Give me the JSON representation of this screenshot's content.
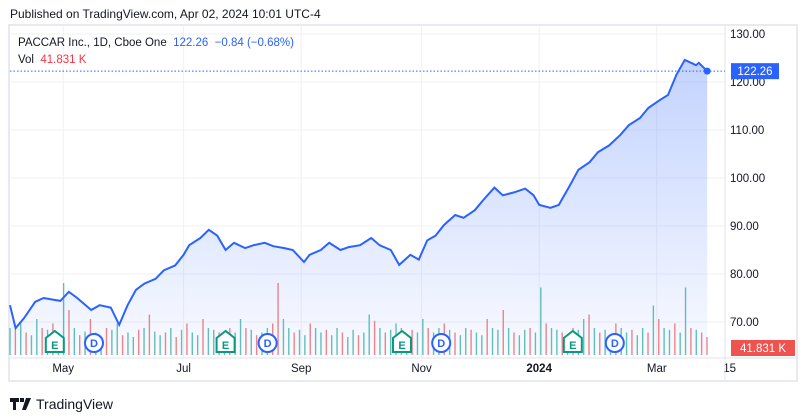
{
  "header": {
    "published": "Published on TradingView.com, Apr 02, 2024 10:01 UTC-4"
  },
  "legend": {
    "symbol": "PACCAR Inc., 1D, Cboe One",
    "price": "122.26",
    "change": "−0.84 (−0.68%)",
    "vol_label": "Vol",
    "vol_value": "41.831 K"
  },
  "footer": {
    "brand": "TradingView"
  },
  "colors": {
    "line": "#2962ff",
    "up": "#26a69a",
    "down": "#ef5350",
    "event_e": "#089981",
    "event_d": "#2962ff"
  },
  "chart_data": {
    "type": "area",
    "title": "PACCAR Inc., 1D, Cboe One",
    "ylim": [
      66,
      131
    ],
    "y_ticks": [
      "130.00",
      "120.00",
      "110.00",
      "100.00",
      "90.00",
      "80.00",
      "70.00"
    ],
    "y_tick_values": [
      130,
      120,
      110,
      100,
      90,
      80,
      70
    ],
    "x_ticks": [
      {
        "label": "May",
        "day": 19
      },
      {
        "label": "Jul",
        "day": 62
      },
      {
        "label": "Sep",
        "day": 104
      },
      {
        "label": "Nov",
        "day": 147
      },
      {
        "label": "2024",
        "day": 189
      },
      {
        "label": "Mar",
        "day": 231
      },
      {
        "label": "15",
        "day": 257
      }
    ],
    "last_price_label": "122.26",
    "last_volume_label": "41.831 K",
    "price_series": [
      [
        0,
        73.5
      ],
      [
        2,
        68.7
      ],
      [
        5,
        70.8
      ],
      [
        9,
        74.2
      ],
      [
        12,
        75
      ],
      [
        18,
        74.4
      ],
      [
        21,
        76.3
      ],
      [
        24,
        75
      ],
      [
        29,
        72.5
      ],
      [
        32,
        73.5
      ],
      [
        36,
        73
      ],
      [
        39,
        69.4
      ],
      [
        42,
        73.5
      ],
      [
        45,
        76.7
      ],
      [
        48,
        78
      ],
      [
        52,
        79
      ],
      [
        55,
        80.8
      ],
      [
        59,
        81.8
      ],
      [
        62,
        84
      ],
      [
        64,
        86
      ],
      [
        68,
        87.5
      ],
      [
        71,
        89.2
      ],
      [
        74,
        88
      ],
      [
        77,
        85
      ],
      [
        80,
        86.5
      ],
      [
        84,
        85.4
      ],
      [
        87,
        86
      ],
      [
        91,
        86.5
      ],
      [
        94,
        85.8
      ],
      [
        98,
        85.4
      ],
      [
        101,
        85
      ],
      [
        105,
        82.5
      ],
      [
        107,
        84
      ],
      [
        111,
        85
      ],
      [
        114,
        86.5
      ],
      [
        118,
        85
      ],
      [
        121,
        85.6
      ],
      [
        125,
        86
      ],
      [
        129,
        87.5
      ],
      [
        132,
        86
      ],
      [
        136,
        85
      ],
      [
        139,
        81.9
      ],
      [
        143,
        84
      ],
      [
        146,
        83
      ],
      [
        149,
        87
      ],
      [
        152,
        88
      ],
      [
        155,
        90.2
      ],
      [
        159,
        92.3
      ],
      [
        162,
        91.7
      ],
      [
        166,
        93.3
      ],
      [
        169,
        95.4
      ],
      [
        173,
        98
      ],
      [
        176,
        96.4
      ],
      [
        180,
        97
      ],
      [
        184,
        97.8
      ],
      [
        187,
        96.4
      ],
      [
        189,
        94.4
      ],
      [
        193,
        93.8
      ],
      [
        196,
        94.4
      ],
      [
        200,
        98.5
      ],
      [
        203,
        101.7
      ],
      [
        207,
        103.3
      ],
      [
        210,
        105.4
      ],
      [
        214,
        106.8
      ],
      [
        218,
        109
      ],
      [
        221,
        111
      ],
      [
        225,
        112.5
      ],
      [
        228,
        114.6
      ],
      [
        232,
        116.2
      ],
      [
        235,
        117.3
      ],
      [
        238,
        121.5
      ],
      [
        241,
        124.6
      ],
      [
        245,
        123.5
      ],
      [
        246,
        124
      ],
      [
        249,
        122.26
      ]
    ],
    "volume_k": [
      30,
      -28,
      35,
      -25,
      22,
      40,
      -30,
      28,
      -35,
      25,
      80,
      -50,
      30,
      -22,
      26,
      -40,
      25,
      20,
      -30,
      28,
      35,
      -22,
      25,
      20,
      -28,
      30,
      -45,
      26,
      22,
      -25,
      30,
      -20,
      28,
      -35,
      25,
      22,
      -40,
      30,
      28,
      -25,
      22,
      -30,
      25,
      40,
      -30,
      28,
      -22,
      25,
      30,
      -35,
      -80,
      40,
      30,
      -25,
      28,
      22,
      -35,
      30,
      25,
      -28,
      22,
      30,
      -25,
      20,
      28,
      -22,
      25,
      45,
      -38,
      30,
      -25,
      28,
      35,
      -30,
      22,
      -28,
      25,
      40,
      -30,
      25,
      30,
      -35,
      28,
      -25,
      22,
      30,
      -28,
      25,
      22,
      -40,
      30,
      28,
      -50,
      30,
      -25,
      22,
      28,
      -30,
      25,
      75,
      -35,
      30,
      28,
      -25,
      22,
      -30,
      28,
      40,
      -45,
      30,
      -25,
      28,
      22,
      -35,
      30,
      25,
      -28,
      22,
      30,
      -25,
      55,
      -40,
      30,
      28,
      -35,
      25,
      75,
      -30,
      28,
      -25,
      -20
    ]
  },
  "events": {
    "earnings": [
      {
        "label": "E",
        "day": 16
      },
      {
        "label": "E",
        "day": 77
      },
      {
        "label": "E",
        "day": 140
      },
      {
        "label": "E",
        "day": 201
      }
    ],
    "dividends": [
      {
        "label": "D",
        "day": 30
      },
      {
        "label": "D",
        "day": 92
      },
      {
        "label": "D",
        "day": 154
      },
      {
        "label": "D",
        "day": 216
      }
    ]
  }
}
